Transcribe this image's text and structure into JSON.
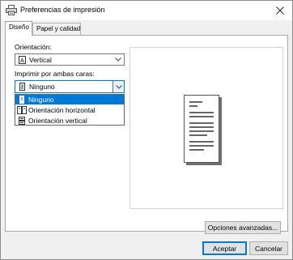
{
  "window": {
    "title": "Preferencias de impresión",
    "title_icon": "printer-icon",
    "close_icon": "close-icon"
  },
  "tabs": [
    {
      "label": "Diseño",
      "active": true
    },
    {
      "label": "Papel y calidad",
      "active": false
    }
  ],
  "orientation": {
    "label": "Orientación:",
    "value": "Vertical",
    "icon": "portrait-page-icon"
  },
  "duplex": {
    "label": "Imprimir por ambas caras:",
    "value": "Ninguno",
    "icon": "single-page-icon",
    "options": [
      {
        "label": "Ninguno",
        "icon": "single-page-icon",
        "selected": true
      },
      {
        "label": "Orientación horizontal",
        "icon": "flip-horizontal-icon",
        "selected": false
      },
      {
        "label": "Orientación vertical",
        "icon": "flip-vertical-icon",
        "selected": false
      }
    ]
  },
  "buttons": {
    "advanced": "Opciones avanzadas...",
    "accept": "Aceptar",
    "cancel": "Cancelar"
  },
  "colors": {
    "selection": "#0078d7",
    "panel": "#ffffff",
    "window": "#f0f0f0"
  }
}
